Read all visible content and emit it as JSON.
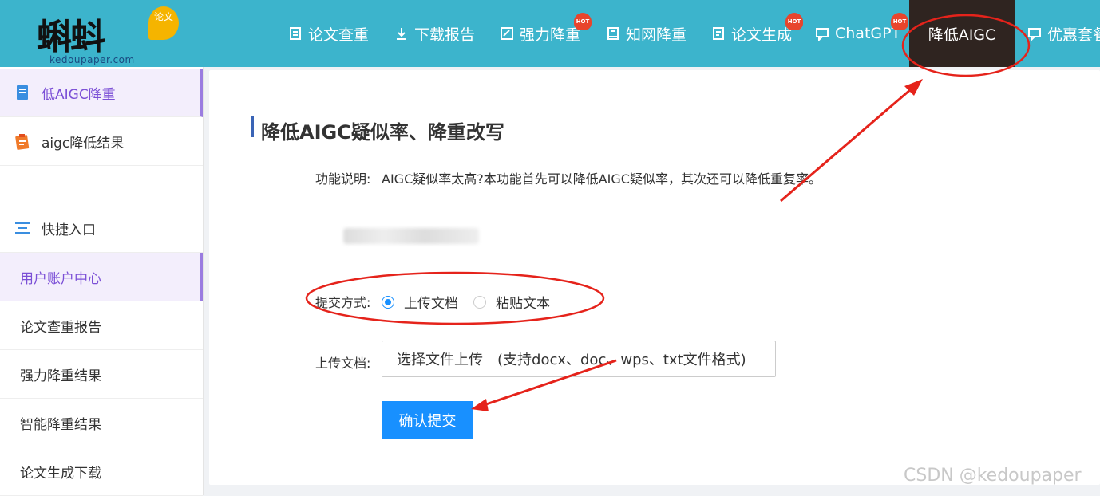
{
  "logo": {
    "badge": "论文",
    "subtext": "kedoupaper.com"
  },
  "nav": [
    {
      "label": "论文查重",
      "icon": "document-icon",
      "hot": false
    },
    {
      "label": "下载报告",
      "icon": "download-icon",
      "hot": false
    },
    {
      "label": "强力降重",
      "icon": "edit-icon",
      "hot": true
    },
    {
      "label": "知网降重",
      "icon": "book-icon",
      "hot": false
    },
    {
      "label": "论文生成",
      "icon": "file-icon",
      "hot": true
    },
    {
      "label": "ChatGPT",
      "icon": "chat-icon",
      "hot": true
    },
    {
      "label": "降低AIGC",
      "active": true
    },
    {
      "label": "优惠套餐",
      "icon": "chat-icon",
      "hot": false
    }
  ],
  "hot_label": "HOT",
  "sidebar": {
    "items": [
      {
        "label": "低AIGC降重",
        "icon": "book-blue-icon"
      },
      {
        "label": "aigc降低结果",
        "icon": "clipboard-orange-icon"
      },
      {
        "label": "快捷入口",
        "icon": "menu-lines-icon"
      },
      {
        "label": "用户账户中心"
      },
      {
        "label": "论文查重报告"
      },
      {
        "label": "强力降重结果"
      },
      {
        "label": "智能降重结果"
      },
      {
        "label": "论文生成下载"
      }
    ]
  },
  "main": {
    "title": "降低AIGC疑似率、降重改写",
    "desc_label": "功能说明:",
    "desc_text": "AIGC疑似率太高?本功能首先可以降低AIGC疑似率，其次还可以降低重复率。",
    "submit_label": "提交方式:",
    "options": [
      {
        "label": "上传文档",
        "selected": true
      },
      {
        "label": "粘贴文本",
        "selected": false
      }
    ],
    "upload_label": "上传文档:",
    "file_button": "选择文件上传　(支持docx、doc、wps、txt文件格式)",
    "confirm_button": "确认提交"
  },
  "colors": {
    "nav_bg": "#3cb4cc",
    "active_nav": "#2f2420",
    "primary": "#1890ff",
    "annotation": "#e5231b"
  },
  "watermark": "CSDN @kedoupaper"
}
